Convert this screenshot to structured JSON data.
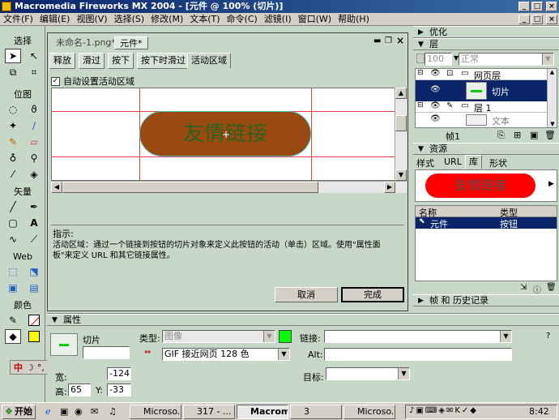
{
  "window": {
    "title": "Macromedia Fireworks MX 2004 - [元件 @ 100% (切片)]",
    "min_label": "_",
    "max_label": "□",
    "close_label": "×"
  },
  "menu": [
    "文件(F)",
    "编辑(E)",
    "视图(V)",
    "选择(S)",
    "修改(M)",
    "文本(T)",
    "命令(C)",
    "滤镜(I)",
    "窗口(W)",
    "帮助(H)"
  ],
  "tools": {
    "select_label": "选择",
    "bitmap_label": "位图",
    "vector_label": "矢量",
    "web_label": "Web",
    "colors_label": "颜色",
    "view_label": "视图"
  },
  "document": {
    "tabs": [
      "未命名-1.png*",
      "元件*"
    ],
    "state_tabs": [
      "释放",
      "滑过",
      "按下",
      "按下时滑过",
      "活动区域"
    ],
    "auto_active_label": "自动设置活动区域",
    "button_text": "友情链接",
    "button_color": "#9a4a10",
    "hint_title": "指示:",
    "hint_text": "活动区域：通过一个链接到按钮的切片对象来定义此按钮的活动（单击）区域。使用\"属性面板\"来定义 URL 和其它链接属性。",
    "cancel_label": "取消",
    "done_label": "完成"
  },
  "panels": {
    "optimize_label": "优化",
    "layers_label": "层",
    "opacity_value": "100",
    "blend_value": "正常",
    "layer_rows": [
      {
        "name": "网页层"
      },
      {
        "name": "切片"
      },
      {
        "name": "层 1"
      },
      {
        "name": "文本"
      }
    ],
    "frame_label": "帧1",
    "assets_label": "资源",
    "asset_tabs": [
      "样式",
      "URL",
      "库",
      "形状"
    ],
    "preview_text": "友情链接",
    "preview_color": "#ff0000",
    "lib_col_name": "名称",
    "lib_col_type": "类型",
    "lib_row_name": "元件",
    "lib_row_type": "按钮",
    "history_label": "帧 和 历史记录"
  },
  "properties": {
    "title": "属性",
    "object_name": "切片",
    "type_label": "类型:",
    "type_value": "图像",
    "format_value": "GIF 接近网页 128 色",
    "link_label": "链接:",
    "alt_label": "Alt:",
    "target_label": "目标:",
    "w_label": "宽:",
    "h_label": "高:",
    "h_value": "65",
    "x_value": "-124",
    "y_label": "Y:",
    "y_value": "-33",
    "ime_text": "中",
    "ime_mode": "简"
  },
  "taskbar": {
    "start_label": "开始",
    "items": [
      "Microso...",
      "317 - ...",
      "Macrom...",
      "3",
      "Microso..."
    ],
    "clock": "8:42"
  }
}
